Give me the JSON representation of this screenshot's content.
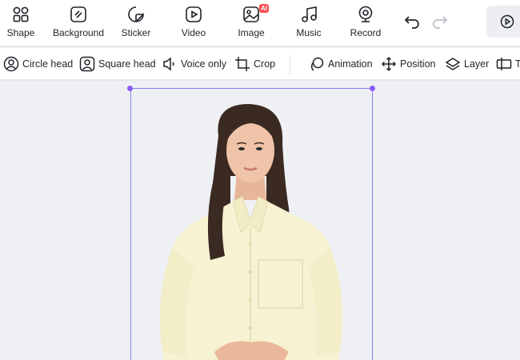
{
  "toolbar": {
    "items": [
      {
        "label": "Shape",
        "icon": "shape-icon"
      },
      {
        "label": "Background",
        "icon": "background-icon"
      },
      {
        "label": "Sticker",
        "icon": "sticker-icon"
      },
      {
        "label": "Video",
        "icon": "video-icon"
      },
      {
        "label": "Image",
        "icon": "image-icon",
        "badge": "AI"
      },
      {
        "label": "Music",
        "icon": "music-icon"
      },
      {
        "label": "Record",
        "icon": "record-icon"
      }
    ],
    "undo_icon": "undo-icon",
    "redo_icon": "redo-icon",
    "preview_icon": "play-icon"
  },
  "subtoolbar": {
    "items": [
      {
        "label": "Circle head",
        "icon": "circle-head-icon"
      },
      {
        "label": "Square head",
        "icon": "square-head-icon"
      },
      {
        "label": "Voice only",
        "icon": "voice-icon"
      },
      {
        "label": "Crop",
        "icon": "crop-icon"
      },
      {
        "label": "Animation",
        "icon": "animation-icon"
      },
      {
        "label": "Position",
        "icon": "position-icon"
      },
      {
        "label": "Layer",
        "icon": "layer-icon"
      },
      {
        "label": "T",
        "icon": "text-box-icon"
      }
    ]
  },
  "colors": {
    "accent": "#8a5cf6",
    "badge": "#ff4d4f",
    "canvas_bg": "#eef0f4"
  }
}
